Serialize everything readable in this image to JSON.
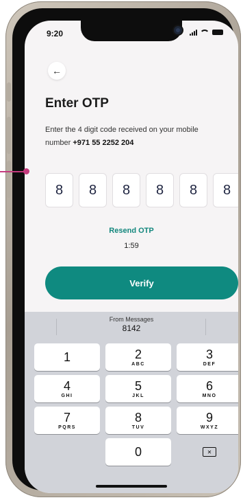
{
  "status_bar": {
    "time": "9:20"
  },
  "header": {
    "title": "Enter OTP"
  },
  "instructions": {
    "text": "Enter the 4 digit code received on your mobile number",
    "phone": "+971 55 2252 204"
  },
  "otp": {
    "digits": [
      "8",
      "8",
      "8",
      "8",
      "8",
      "8"
    ]
  },
  "resend": {
    "label": "Resend OTP",
    "timer": "1:59"
  },
  "verify": {
    "label": "Verify"
  },
  "keyboard": {
    "suggestion_source": "From Messages",
    "suggestion_code": "8142",
    "keys": [
      {
        "num": "1",
        "letters": ""
      },
      {
        "num": "2",
        "letters": "ABC"
      },
      {
        "num": "3",
        "letters": "DEF"
      },
      {
        "num": "4",
        "letters": "GHI"
      },
      {
        "num": "5",
        "letters": "JKL"
      },
      {
        "num": "6",
        "letters": "MNO"
      },
      {
        "num": "7",
        "letters": "PQRS"
      },
      {
        "num": "8",
        "letters": "TUV"
      },
      {
        "num": "9",
        "letters": "WXYZ"
      },
      {
        "num": "0",
        "letters": ""
      }
    ]
  },
  "icons": {
    "back": "arrow-left-icon",
    "backspace": "backspace-icon"
  },
  "colors": {
    "accent": "#0f8a80",
    "resend": "#13877d",
    "callout": "#c43a7d"
  }
}
